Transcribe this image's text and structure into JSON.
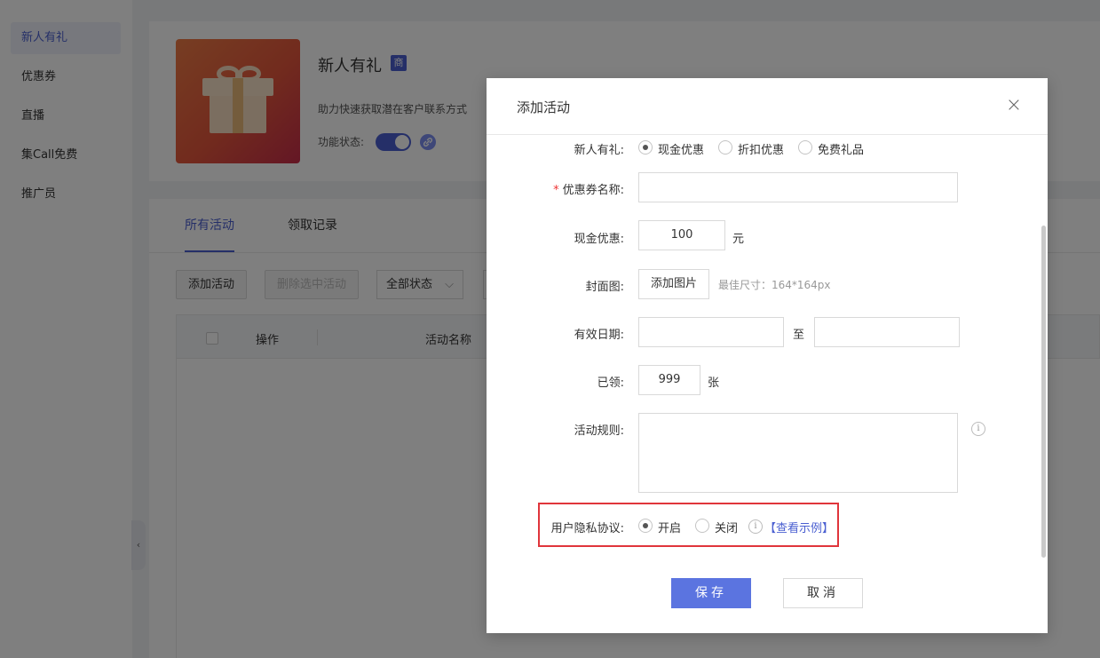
{
  "sidebar": {
    "items": [
      {
        "label": "新人有礼"
      },
      {
        "label": "优惠券"
      },
      {
        "label": "直播"
      },
      {
        "label": "集Call免费"
      },
      {
        "label": "推广员"
      }
    ],
    "collapse_glyph": "‹"
  },
  "feature": {
    "title": "新人有礼",
    "tag": "商",
    "description": "助力快速获取潜在客户联系方式",
    "status_label": "功能状态:",
    "status_on": true
  },
  "list": {
    "tabs": [
      "所有活动",
      "领取记录"
    ],
    "toolbar": {
      "add_label": "添加活动",
      "delete_label": "删除选中活动",
      "status_select": "全部状态"
    },
    "columns": [
      "操作",
      "活动名称"
    ]
  },
  "modal": {
    "title": "添加活动",
    "close_glyph": "×",
    "form": {
      "gift_type_label": "新人有礼:",
      "gift_type_options": [
        "现金优惠",
        "折扣优惠",
        "免费礼品"
      ],
      "gift_type_selected": "现金优惠",
      "coupon_name_label": "优惠券名称:",
      "coupon_name_required_mark": "*",
      "coupon_name_value": "",
      "cash_label": "现金优惠:",
      "cash_value": "100",
      "cash_unit": "元",
      "cover_label": "封面图:",
      "cover_button": "添加图片",
      "cover_hint": "最佳尺寸：164*164px",
      "date_label": "有效日期:",
      "date_sep": "至",
      "date_start": "",
      "date_end": "",
      "claimed_label": "已领:",
      "claimed_value": "999",
      "claimed_unit": "张",
      "rules_label": "活动规则:",
      "rules_value": "",
      "privacy_label": "用户隐私协议:",
      "privacy_options": [
        "开启",
        "关闭"
      ],
      "privacy_selected": "开启",
      "privacy_example_link": "【查看示例】"
    },
    "save_label": "保存",
    "cancel_label": "取消"
  }
}
